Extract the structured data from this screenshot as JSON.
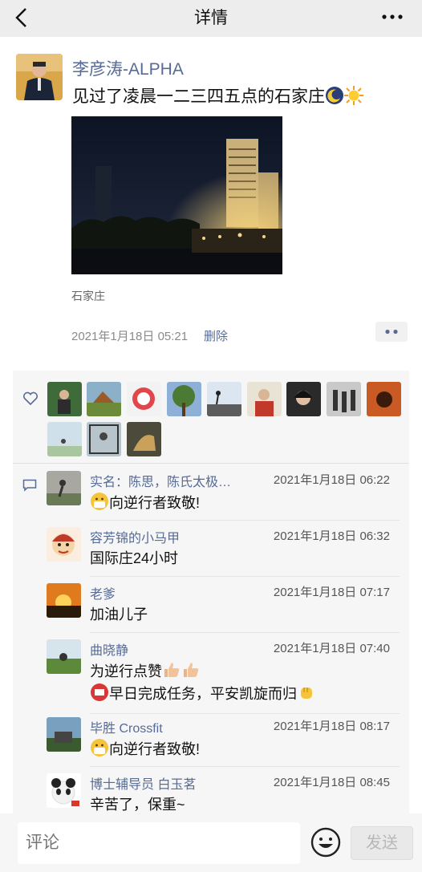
{
  "header": {
    "title": "详情"
  },
  "post": {
    "author": "李彦涛-ALPHA",
    "text": "见过了凌晨一二三四五点的石家庄",
    "location": "石家庄",
    "time": "2021年1月18日 05:21",
    "delete_label": "删除"
  },
  "likes": {
    "icon": "heart-icon",
    "count": 12
  },
  "comments": [
    {
      "name": "实名：陈思，陈氏太极…",
      "time": "2021年1月18日 06:22",
      "lines": [
        "向逆行者致敬!"
      ]
    },
    {
      "name": "容芳锦的小马甲",
      "time": "2021年1月18日 06:32",
      "lines": [
        "国际庄24小时"
      ]
    },
    {
      "name": "老爹",
      "time": "2021年1月18日 07:17",
      "lines": [
        "加油儿子"
      ]
    },
    {
      "name": "曲晓静",
      "time": "2021年1月18日 07:40",
      "lines": [
        "为逆行点赞",
        "早日完成任务，平安凯旋而归"
      ]
    },
    {
      "name": "毕胜 Crossfit",
      "time": "2021年1月18日 08:17",
      "lines": [
        "向逆行者致敬!"
      ]
    },
    {
      "name": "博士辅导员 白玉茗",
      "time": "2021年1月18日 08:45",
      "lines": [
        "辛苦了，保重~"
      ]
    }
  ],
  "footer": {
    "placeholder": "评论",
    "send_label": "发送"
  },
  "colors": {
    "link": "#576b95",
    "panel": "#f6f6f6",
    "topbar": "#ededed"
  }
}
